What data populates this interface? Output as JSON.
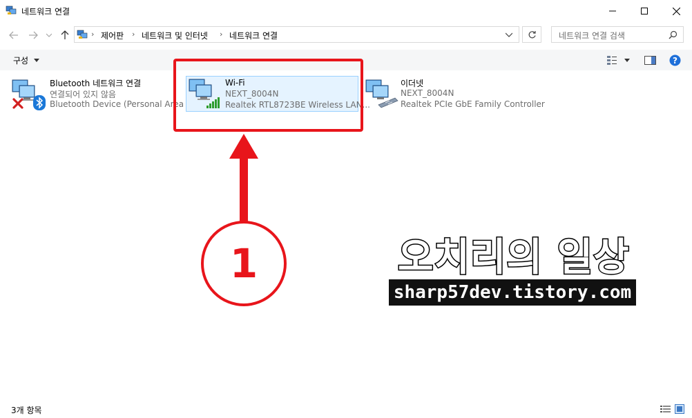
{
  "window": {
    "title": "네트워크 연결"
  },
  "breadcrumb": [
    "제어판",
    "네트워크 및 인터넷",
    "네트워크 연결"
  ],
  "search": {
    "placeholder": "네트워크 연결 검색"
  },
  "toolbar": {
    "organize_label": "구성"
  },
  "items": [
    {
      "name": "Bluetooth 네트워크 연결",
      "status": "연결되어 있지 않음",
      "device": "Bluetooth Device (Personal Area ..."
    },
    {
      "name": "Wi-Fi",
      "status": "NEXT_8004N",
      "device": "Realtek RTL8723BE Wireless LAN..."
    },
    {
      "name": "이더넷",
      "status": "NEXT_8004N",
      "device": "Realtek PCIe GbE Family Controller"
    }
  ],
  "statusbar": {
    "count": "3개 항목"
  },
  "watermark": {
    "title": "오치리의 일상",
    "url": "sharp57dev.tistory.com"
  },
  "annotation": {
    "number": "1",
    "color": "#e8151b"
  },
  "colors": {
    "selection_bg": "#e5f3ff",
    "selection_border": "#99d1ff",
    "help": "#1e6fd9"
  }
}
